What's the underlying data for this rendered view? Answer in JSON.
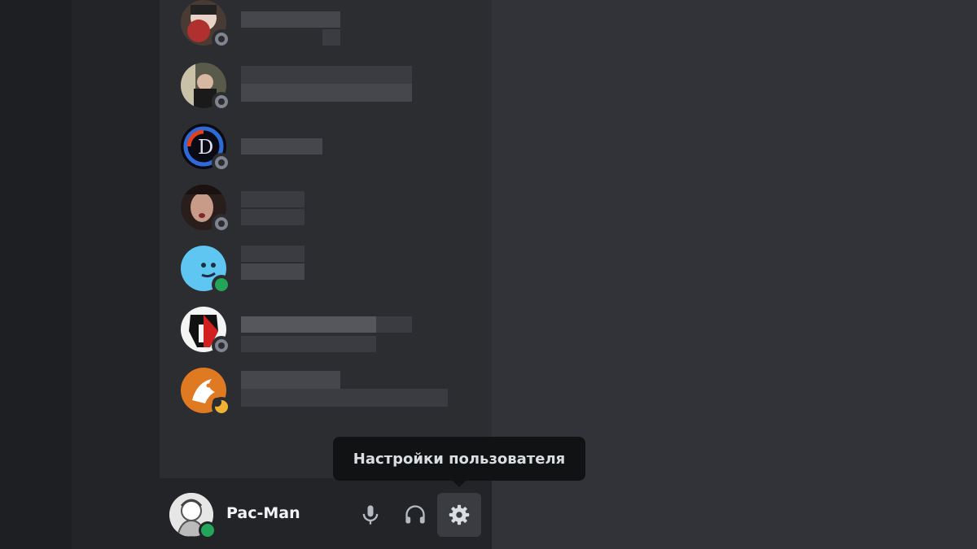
{
  "colors": {
    "background": "#313338",
    "panel": "#2b2d31",
    "user_bar": "#232428",
    "online": "#23a55a",
    "idle": "#f0b232",
    "offline": "#80848e",
    "tooltip_bg": "#111214"
  },
  "dm_list": [
    {
      "avatar": "anime-avatar",
      "status": "offline",
      "name": "",
      "subtitle": ""
    },
    {
      "avatar": "photo-avatar",
      "status": "offline",
      "name": "",
      "subtitle": ""
    },
    {
      "avatar": "letter-d-avatar",
      "status": "offline",
      "name": "",
      "subtitle": ""
    },
    {
      "avatar": "face-photo-avatar",
      "status": "offline",
      "name": "",
      "subtitle": ""
    },
    {
      "avatar": "blue-smiley-avatar",
      "status": "online",
      "name": "",
      "subtitle": ""
    },
    {
      "avatar": "spartan-helmet-avatar",
      "status": "offline",
      "name": "",
      "subtitle": ""
    },
    {
      "avatar": "orange-fox-avatar",
      "status": "idle",
      "name": "",
      "subtitle": ""
    }
  ],
  "user_panel": {
    "username": "Pac-Man",
    "status": "online",
    "controls": [
      "microphone-icon",
      "headphones-icon",
      "gear-icon"
    ]
  },
  "tooltip": {
    "text": "Настройки пользователя"
  }
}
